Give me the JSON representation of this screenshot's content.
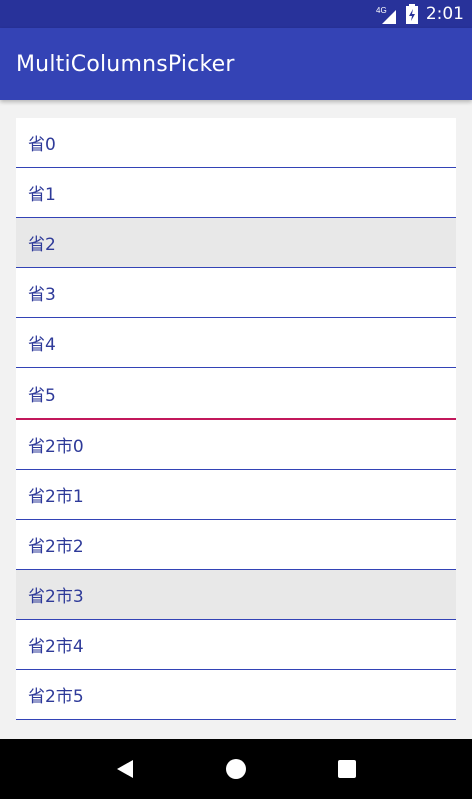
{
  "status_bar": {
    "network_label": "4G",
    "time": "2:01"
  },
  "app_bar": {
    "title": "MultiColumnsPicker"
  },
  "province_column": {
    "items": [
      {
        "label": "省0",
        "selected": false
      },
      {
        "label": "省1",
        "selected": false
      },
      {
        "label": "省2",
        "selected": true
      },
      {
        "label": "省3",
        "selected": false
      },
      {
        "label": "省4",
        "selected": false
      },
      {
        "label": "省5",
        "selected": false
      }
    ]
  },
  "city_column": {
    "items": [
      {
        "label": "省2市0",
        "selected": false
      },
      {
        "label": "省2市1",
        "selected": false
      },
      {
        "label": "省2市2",
        "selected": false
      },
      {
        "label": "省2市3",
        "selected": true
      },
      {
        "label": "省2市4",
        "selected": false
      },
      {
        "label": "省2市5",
        "selected": false
      }
    ]
  },
  "colors": {
    "primary": "#3443b5",
    "primary_dark": "#28329a",
    "accent": "#c2185b",
    "selected_row": "#e8e8e8",
    "text": "#2e3a99"
  },
  "nav_bar": {
    "back_icon": "triangle-back-icon",
    "home_icon": "circle-home-icon",
    "recents_icon": "square-recents-icon"
  }
}
